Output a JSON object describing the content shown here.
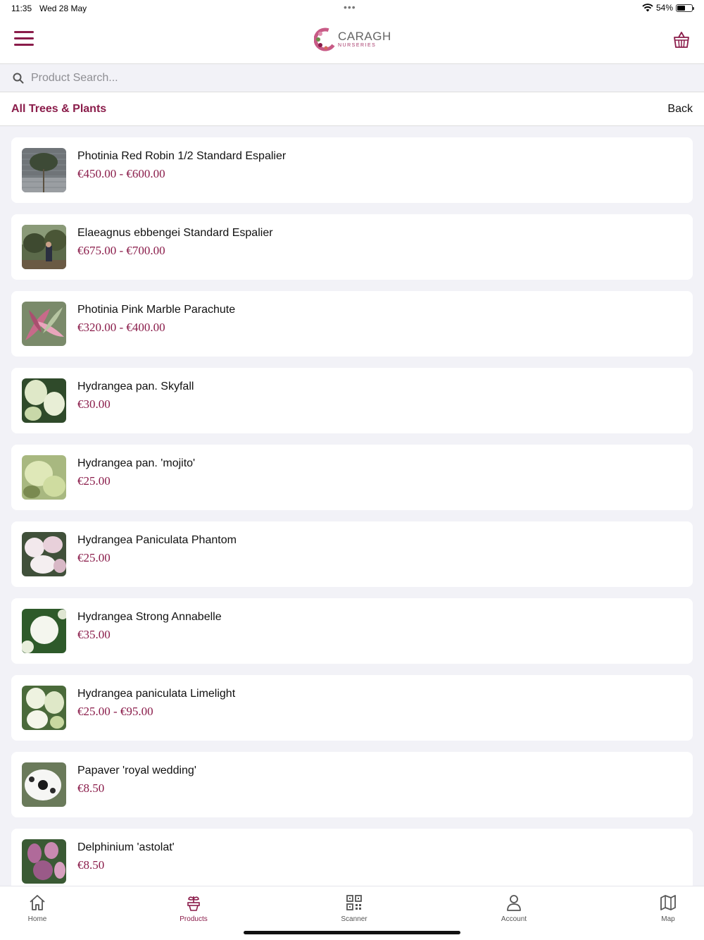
{
  "status_bar": {
    "time": "11:35",
    "date": "Wed 28 May",
    "battery": "54%",
    "battery_level": 0.54
  },
  "header": {
    "logo_name": "CARAGH",
    "logo_sub": "NURSERIES",
    "menu_icon": "hamburger-icon",
    "basket_icon": "basket-icon"
  },
  "search": {
    "placeholder": "Product Search...",
    "value": ""
  },
  "nav": {
    "breadcrumb": "All Trees & Plants",
    "back": "Back"
  },
  "products": [
    {
      "name": "Photinia Red Robin 1/2 Standard Espalier",
      "price": "€450.00 - €600.00"
    },
    {
      "name": "Elaeagnus ebbengei Standard Espalier",
      "price": "€675.00 - €700.00"
    },
    {
      "name": "Photinia Pink Marble Parachute",
      "price": "€320.00 - €400.00"
    },
    {
      "name": "Hydrangea pan. Skyfall",
      "price": "€30.00"
    },
    {
      "name": "Hydrangea pan. 'mojito'",
      "price": "€25.00"
    },
    {
      "name": "Hydrangea Paniculata Phantom",
      "price": "€25.00"
    },
    {
      "name": "Hydrangea Strong Annabelle",
      "price": "€35.00"
    },
    {
      "name": "Hydrangea paniculata Limelight",
      "price": "€25.00 - €95.00"
    },
    {
      "name": "Papaver 'royal wedding'",
      "price": "€8.50"
    },
    {
      "name": "Delphinium 'astolat'",
      "price": "€8.50"
    }
  ],
  "tabs": [
    {
      "label": "Home",
      "icon": "home-icon",
      "active": false
    },
    {
      "label": "Products",
      "icon": "plant-pot-icon",
      "active": true
    },
    {
      "label": "Scanner",
      "icon": "qr-code-icon",
      "active": false
    },
    {
      "label": "Account",
      "icon": "user-icon",
      "active": false
    },
    {
      "label": "Map",
      "icon": "map-icon",
      "active": false
    }
  ],
  "colors": {
    "accent": "#8a1c4a",
    "background": "#f2f2f7"
  }
}
